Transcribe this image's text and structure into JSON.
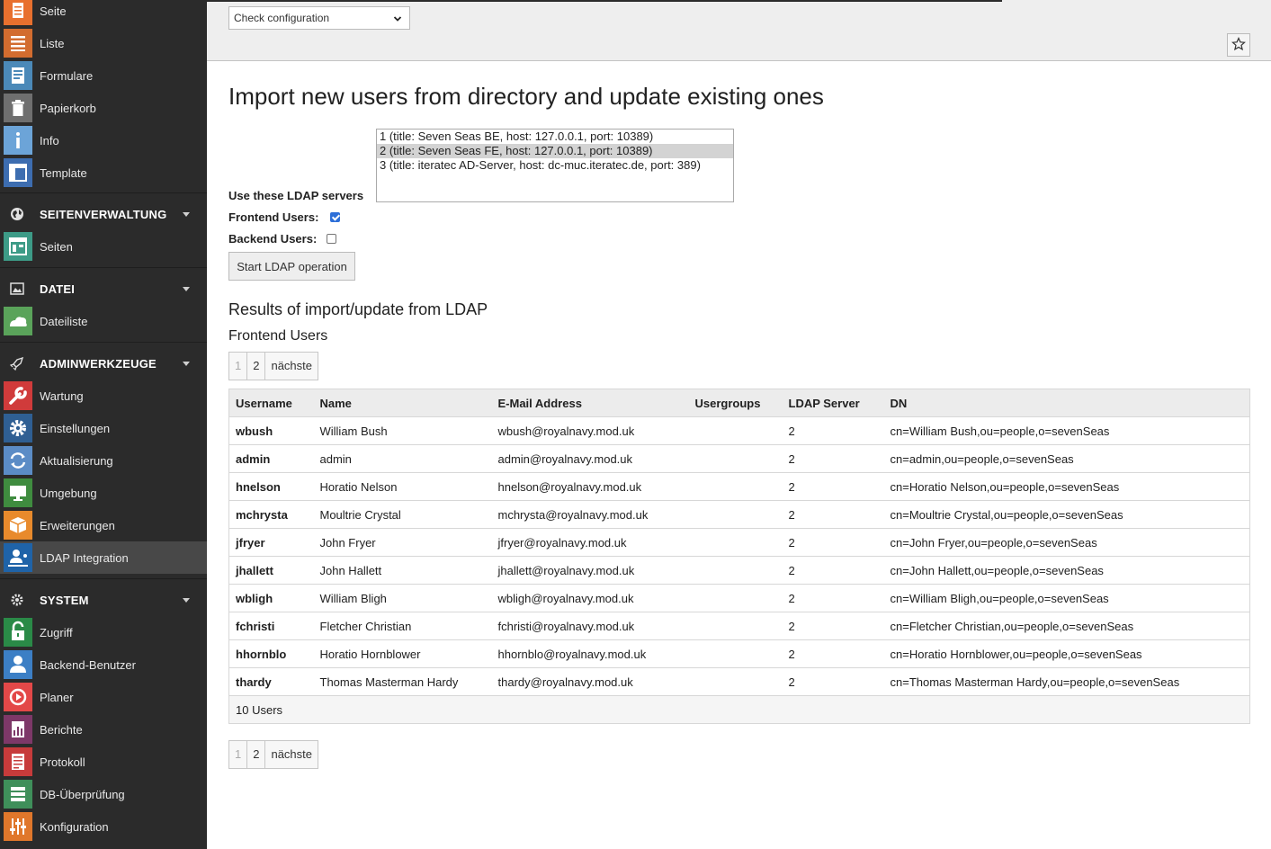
{
  "sidebar": {
    "items_top": [
      {
        "label": "Seite",
        "icon": "page-icon",
        "color": "#e8702e"
      },
      {
        "label": "Liste",
        "icon": "list-icon",
        "color": "#d26c2f"
      },
      {
        "label": "Formulare",
        "icon": "forms-icon",
        "color": "#4b89b8"
      },
      {
        "label": "Papierkorb",
        "icon": "trash-icon",
        "color": "#6f6f6f"
      },
      {
        "label": "Info",
        "icon": "info-icon",
        "color": "#6ca4d8"
      },
      {
        "label": "Template",
        "icon": "template-icon",
        "color": "#3d6db0"
      }
    ],
    "groups": [
      {
        "label": "SEITENVERWALTUNG",
        "icon": "globe-icon",
        "items": [
          {
            "label": "Seiten",
            "icon": "pages-icon",
            "color": "#3d9b87"
          }
        ]
      },
      {
        "label": "DATEI",
        "icon": "image-icon",
        "items": [
          {
            "label": "Dateiliste",
            "icon": "filelist-icon",
            "color": "#5aa35a"
          }
        ]
      },
      {
        "label": "ADMINWERKZEUGE",
        "icon": "rocket-icon",
        "items": [
          {
            "label": "Wartung",
            "icon": "wrench-icon",
            "color": "#d03b3b"
          },
          {
            "label": "Einstellungen",
            "icon": "gear-icon",
            "color": "#2f5f93"
          },
          {
            "label": "Aktualisierung",
            "icon": "refresh-icon",
            "color": "#5b8cc6"
          },
          {
            "label": "Umgebung",
            "icon": "monitor-icon",
            "color": "#3f8c3f"
          },
          {
            "label": "Erweiterungen",
            "icon": "box-icon",
            "color": "#e88a2c"
          },
          {
            "label": "LDAP Integration",
            "icon": "ldap-icon",
            "color": "#1f63a8"
          }
        ]
      },
      {
        "label": "SYSTEM",
        "icon": "gear-small-icon",
        "items": [
          {
            "label": "Zugriff",
            "icon": "lock-icon",
            "color": "#2a8a47"
          },
          {
            "label": "Backend-Benutzer",
            "icon": "user-icon",
            "color": "#3c7fc5"
          },
          {
            "label": "Planer",
            "icon": "clock-icon",
            "color": "#e34848"
          },
          {
            "label": "Berichte",
            "icon": "report-icon",
            "color": "#7d3868"
          },
          {
            "label": "Protokoll",
            "icon": "log-icon",
            "color": "#c73b3b"
          },
          {
            "label": "DB-Überprüfung",
            "icon": "database-icon",
            "color": "#3f8f5a"
          },
          {
            "label": "Konfiguration",
            "icon": "sliders-icon",
            "color": "#e0772b"
          }
        ]
      }
    ]
  },
  "docheader": {
    "function_select": "Check configuration",
    "bookmark_icon": "star-icon"
  },
  "main": {
    "title": "Import new users from directory and update existing ones",
    "servers_label": "Use these LDAP servers",
    "servers": [
      "1 (title: Seven Seas BE, host: 127.0.0.1, port: 10389)",
      "2 (title: Seven Seas FE, host: 127.0.0.1, port: 10389)",
      "3 (title: iteratec AD-Server, host: dc-muc.iteratec.de, port: 389)"
    ],
    "selected_server": 1,
    "frontend_label": "Frontend Users:",
    "frontend_checked": true,
    "backend_label": "Backend Users:",
    "backend_checked": false,
    "start_button": "Start LDAP operation",
    "results_title": "Results of import/update from LDAP",
    "frontend_title": "Frontend Users",
    "pager": {
      "p1": "1",
      "p2": "2",
      "next": "nächste"
    },
    "table": {
      "headers": [
        "Username",
        "Name",
        "E-Mail Address",
        "Usergroups",
        "LDAP Server",
        "DN"
      ],
      "rows": [
        [
          "wbush",
          "William Bush",
          "wbush@royalnavy.mod.uk",
          "",
          "2",
          "cn=William Bush,ou=people,o=sevenSeas"
        ],
        [
          "admin",
          "admin",
          "admin@royalnavy.mod.uk",
          "",
          "2",
          "cn=admin,ou=people,o=sevenSeas"
        ],
        [
          "hnelson",
          "Horatio Nelson",
          "hnelson@royalnavy.mod.uk",
          "",
          "2",
          "cn=Horatio Nelson,ou=people,o=sevenSeas"
        ],
        [
          "mchrysta",
          "Moultrie Crystal",
          "mchrysta@royalnavy.mod.uk",
          "",
          "2",
          "cn=Moultrie Crystal,ou=people,o=sevenSeas"
        ],
        [
          "jfryer",
          "John Fryer",
          "jfryer@royalnavy.mod.uk",
          "",
          "2",
          "cn=John Fryer,ou=people,o=sevenSeas"
        ],
        [
          "jhallett",
          "John Hallett",
          "jhallett@royalnavy.mod.uk",
          "",
          "2",
          "cn=John Hallett,ou=people,o=sevenSeas"
        ],
        [
          "wbligh",
          "William Bligh",
          "wbligh@royalnavy.mod.uk",
          "",
          "2",
          "cn=William Bligh,ou=people,o=sevenSeas"
        ],
        [
          "fchristi",
          "Fletcher Christian",
          "fchristi@royalnavy.mod.uk",
          "",
          "2",
          "cn=Fletcher Christian,ou=people,o=sevenSeas"
        ],
        [
          "hhornblo",
          "Horatio Hornblower",
          "hhornblo@royalnavy.mod.uk",
          "",
          "2",
          "cn=Horatio Hornblower,ou=people,o=sevenSeas"
        ],
        [
          "thardy",
          "Thomas Masterman Hardy",
          "thardy@royalnavy.mod.uk",
          "",
          "2",
          "cn=Thomas Masterman Hardy,ou=people,o=sevenSeas"
        ]
      ],
      "footer": "10 Users"
    }
  }
}
